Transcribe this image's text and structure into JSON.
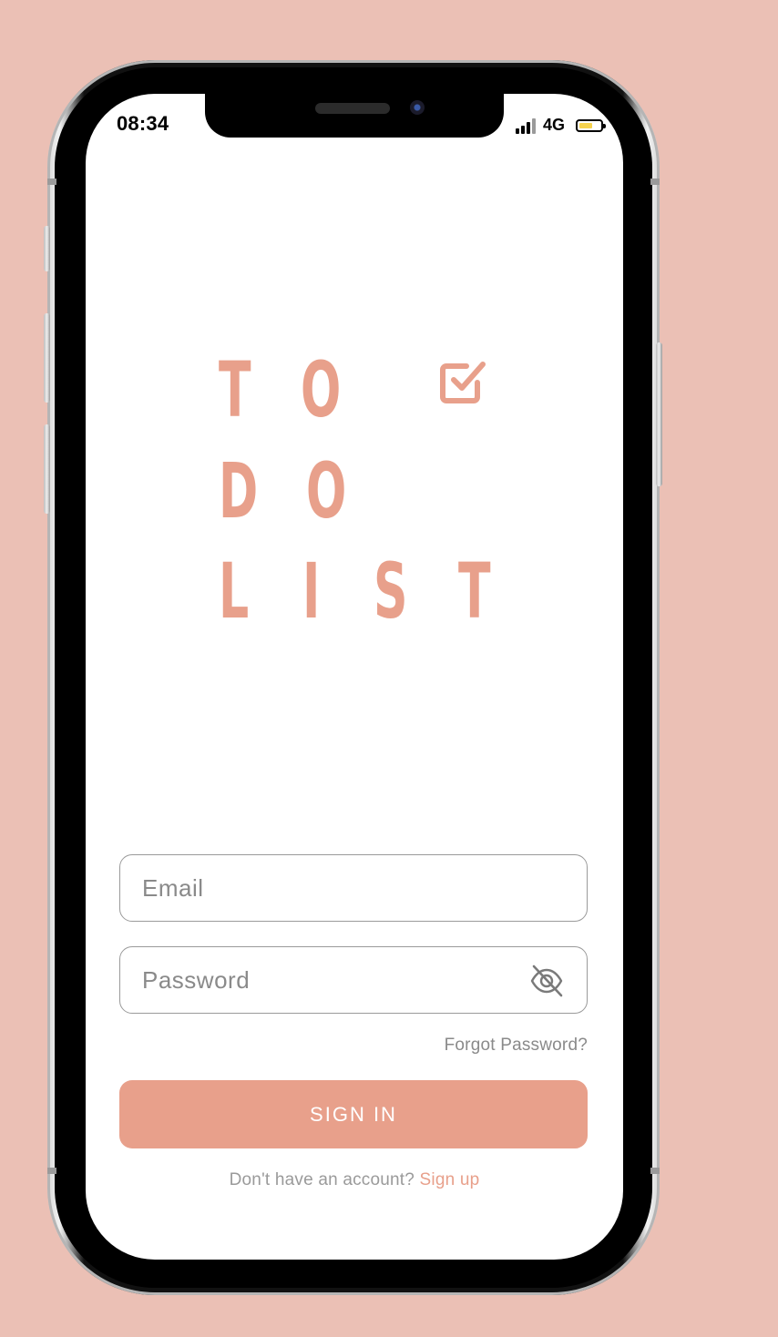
{
  "status_bar": {
    "time": "08:34",
    "network": "4G",
    "battery_color": "#F6D34E"
  },
  "logo": {
    "letters": [
      "T",
      "O",
      "D",
      "O",
      "L",
      "I",
      "S",
      "T"
    ],
    "icon": "checkbox-checked-icon",
    "color": "#E8A08B"
  },
  "form": {
    "email_placeholder": "Email",
    "password_placeholder": "Password",
    "password_toggle_icon": "eye-off-icon",
    "forgot_password": "Forgot Password?",
    "sign_in_label": "SIGN IN"
  },
  "signup": {
    "prompt": "Don't have an account?",
    "link": "Sign up"
  },
  "theme": {
    "accent": "#E8A08B",
    "background": "#EBC0B5"
  }
}
